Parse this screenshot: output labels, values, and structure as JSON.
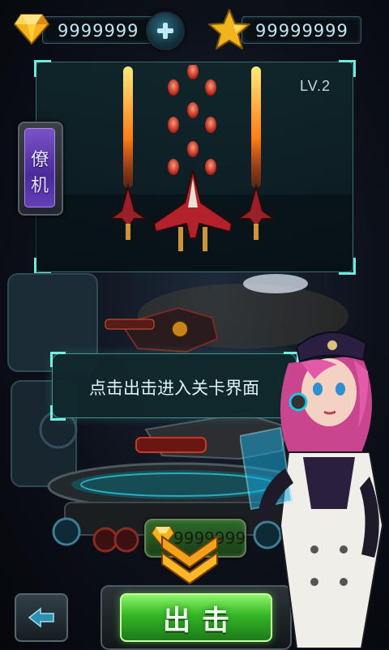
{
  "currency": {
    "gems": "9999999",
    "stars": "99999999"
  },
  "preview": {
    "level": "LV.2"
  },
  "side_tab": {
    "char1": "僚",
    "char2": "机"
  },
  "tutorial": {
    "hint": "点击出击进入关卡界面"
  },
  "upgrade": {
    "cost": "9999999"
  },
  "buttons": {
    "start": "出击"
  },
  "icons": {
    "gem": "diamond-gem-icon",
    "add": "plus-icon",
    "star": "gold-star-icon",
    "back": "left-arrow-icon",
    "chevron": "double-chevron-down-icon"
  },
  "colors": {
    "panel_frame": "#6fe9e0",
    "start_green": "#34b626",
    "wingman_tab": "#7a52c8",
    "gold": "#f2b41c"
  }
}
